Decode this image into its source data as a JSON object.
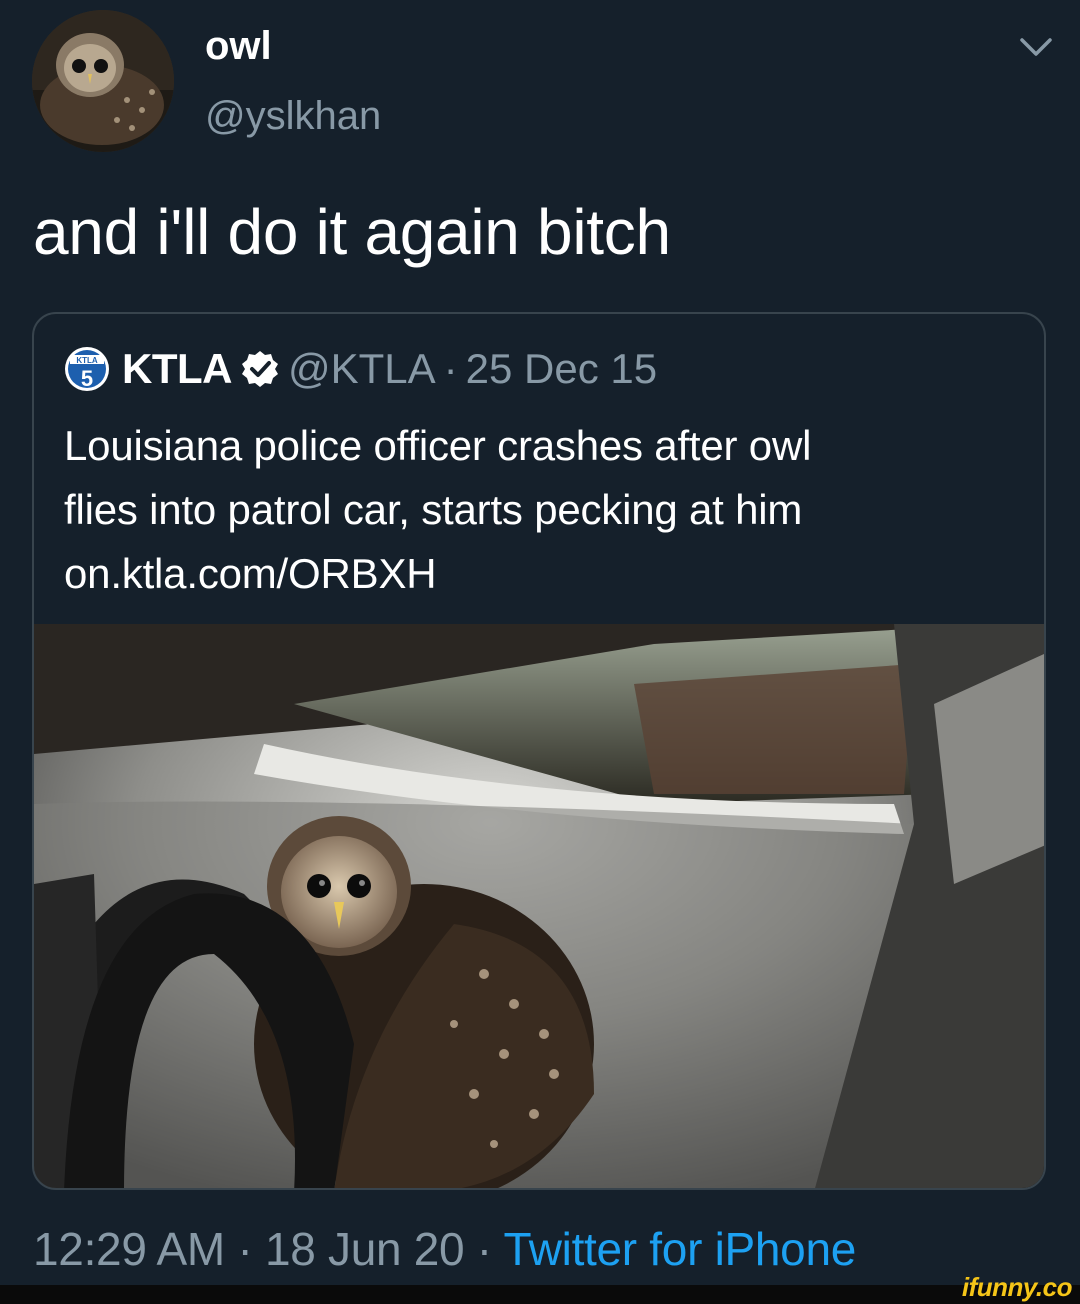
{
  "tweet": {
    "display_name": "owl",
    "handle": "@yslkhan",
    "text": "and i'll do it again bitch",
    "avatar_icon": "owl-avatar",
    "menu_icon": "chevron-down-icon"
  },
  "quote": {
    "logo_icon": "ktla5-logo-icon",
    "logo_text": "KTLA",
    "logo_number": "5",
    "name": "KTLA",
    "verified_icon": "verified-badge-icon",
    "handle": "@KTLA",
    "separator": "·",
    "date": "25 Dec 15",
    "text_lines": [
      "Louisiana police officer crashes after owl",
      "flies into patrol car, starts pecking at him",
      "on.ktla.com/ORBXH"
    ],
    "photo_icon": "owl-in-patrol-car-photo"
  },
  "meta": {
    "time": "12:29 AM",
    "sep1": " · ",
    "date": "18 Jun 20",
    "sep2": " · ",
    "source": "Twitter for iPhone"
  },
  "watermark": "ifunny.co",
  "colors": {
    "background": "#15202b",
    "secondary_text": "#8899a6",
    "link": "#1da1f2",
    "border": "#38444d",
    "watermark": "#f5c518"
  }
}
